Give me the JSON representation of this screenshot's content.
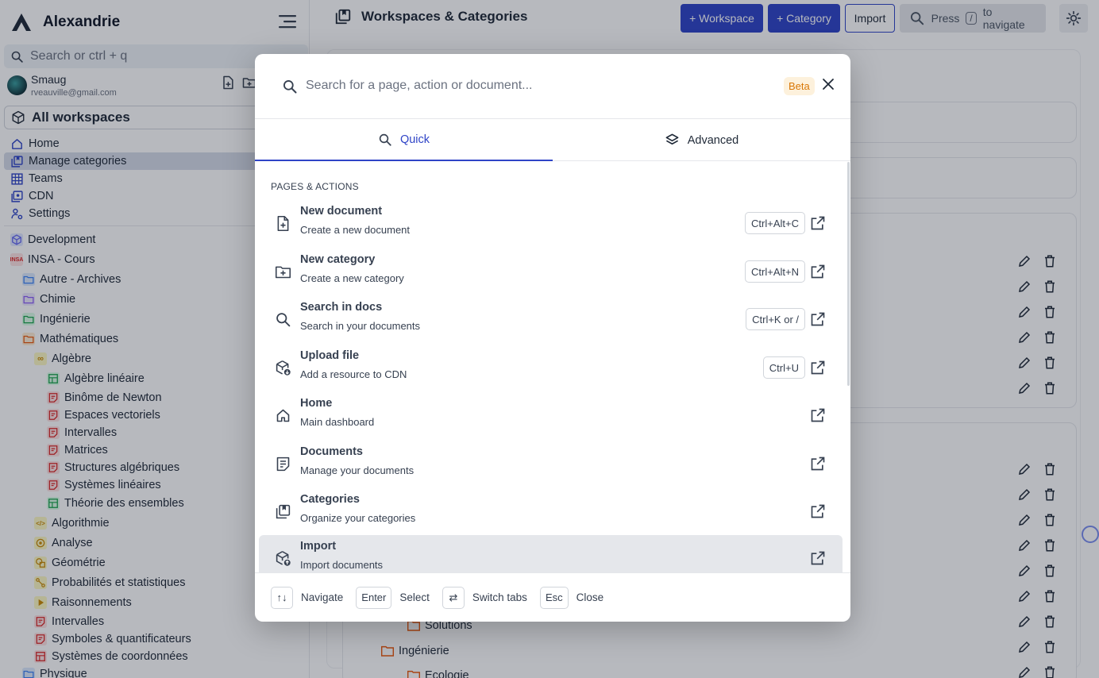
{
  "app": {
    "name": "Alexandrie"
  },
  "sidebar": {
    "search_placeholder": "Search or ctrl + q",
    "user": {
      "name": "Smaug",
      "email": "rveauville@gmail.com"
    },
    "all_workspaces": "All workspaces",
    "nav": [
      {
        "label": "Home",
        "icon": "home-icon"
      },
      {
        "label": "Manage categories",
        "icon": "categories-icon",
        "active": true
      },
      {
        "label": "Teams",
        "icon": "teams-icon"
      },
      {
        "label": "CDN",
        "icon": "cdn-icon"
      },
      {
        "label": "Settings",
        "icon": "settings-icon"
      }
    ],
    "tree": [
      {
        "label": "Development",
        "icon": "workspace-icon",
        "color": "#6366f1"
      },
      {
        "label": "INSA - Cours",
        "icon": "insa-logo-icon",
        "color": "#dc2626"
      },
      {
        "label": "Autre - Archives",
        "icon": "folder-icon",
        "color": "#3b82f6"
      },
      {
        "label": "Chimie",
        "icon": "folder-icon",
        "color": "#8b5cf6"
      },
      {
        "label": "Ingénierie",
        "icon": "folder-icon",
        "color": "#16a34a"
      },
      {
        "label": "Mathématiques",
        "icon": "folder-icon",
        "color": "#ea580c"
      },
      {
        "label": "Algèbre",
        "icon": "infinity-icon",
        "color": "#eab308"
      },
      {
        "label": "Algèbre linéaire",
        "icon": "layout-icon",
        "color": "#16a34a"
      },
      {
        "label": "Binôme de Newton",
        "icon": "document-icon",
        "color": "#dc2626"
      },
      {
        "label": "Espaces vectoriels",
        "icon": "document-icon",
        "color": "#dc2626"
      },
      {
        "label": "Intervalles",
        "icon": "document-icon",
        "color": "#dc2626"
      },
      {
        "label": "Matrices",
        "icon": "document-icon",
        "color": "#dc2626"
      },
      {
        "label": "Structures algébriques",
        "icon": "document-icon",
        "color": "#dc2626"
      },
      {
        "label": "Systèmes linéaires",
        "icon": "document-icon",
        "color": "#dc2626"
      },
      {
        "label": "Théorie des ensembles",
        "icon": "layout-icon",
        "color": "#16a34a"
      },
      {
        "label": "Algorithmie",
        "icon": "code-icon",
        "color": "#eab308"
      },
      {
        "label": "Analyse",
        "icon": "analysis-icon",
        "color": "#eab308"
      },
      {
        "label": "Géométrie",
        "icon": "geometry-icon",
        "color": "#eab308"
      },
      {
        "label": "Probabilités et statistiques",
        "icon": "stats-icon",
        "color": "#eab308"
      },
      {
        "label": "Raisonnements",
        "icon": "play-icon",
        "color": "#eab308"
      },
      {
        "label": "Intervalles",
        "icon": "document-icon",
        "color": "#dc2626"
      },
      {
        "label": "Symboles & quantificateurs",
        "icon": "document-icon",
        "color": "#dc2626"
      },
      {
        "label": "Systèmes de coordonnées",
        "icon": "layout-icon",
        "color": "#dc2626"
      },
      {
        "label": "Physique",
        "icon": "folder-icon",
        "color": "#3b82f6"
      }
    ]
  },
  "topbar": {
    "title": "Workspaces & Categories",
    "add_workspace": "+ Workspace",
    "add_category": "+ Category",
    "import": "Import",
    "search_prefix": "Press",
    "search_key": "/",
    "search_suffix": "to navigate"
  },
  "background": {
    "tree": [
      {
        "label": "Solutions",
        "color": "#ea580c"
      },
      {
        "label": "Ingénierie",
        "color": "#ea580c"
      },
      {
        "label": "Ecologie",
        "color": "#ea580c"
      }
    ]
  },
  "modal": {
    "search_placeholder": "Search for a page, action or document...",
    "badge": "Beta",
    "tabs": [
      {
        "label": "Quick",
        "icon": "search-icon",
        "active": true
      },
      {
        "label": "Advanced",
        "icon": "layers-icon"
      }
    ],
    "section": "PAGES & ACTIONS",
    "items": [
      {
        "title": "New document",
        "desc": "Create a new document",
        "shortcut": "Ctrl+Alt+C",
        "icon": "file-plus-icon"
      },
      {
        "title": "New category",
        "desc": "Create a new category",
        "shortcut": "Ctrl+Alt+N",
        "icon": "folder-plus-icon"
      },
      {
        "title": "Search in docs",
        "desc": "Search in your documents",
        "shortcut": "Ctrl+K or /",
        "icon": "search-icon"
      },
      {
        "title": "Upload file",
        "desc": "Add a resource to CDN",
        "shortcut": "Ctrl+U",
        "icon": "upload-box-icon"
      },
      {
        "title": "Home",
        "desc": "Main dashboard",
        "shortcut": "",
        "icon": "home-icon"
      },
      {
        "title": "Documents",
        "desc": "Manage your documents",
        "shortcut": "",
        "icon": "documents-icon"
      },
      {
        "title": "Categories",
        "desc": "Organize your categories",
        "shortcut": "",
        "icon": "categories-icon"
      },
      {
        "title": "Import",
        "desc": "Import documents",
        "shortcut": "",
        "icon": "import-box-icon",
        "highlighted": true
      }
    ],
    "footer": {
      "navigate_key": "↑↓",
      "navigate_label": "Navigate",
      "enter_key": "Enter",
      "select_label": "Select",
      "switch_key": "⇄",
      "switch_label": "Switch tabs",
      "esc_key": "Esc",
      "close_label": "Close"
    }
  }
}
